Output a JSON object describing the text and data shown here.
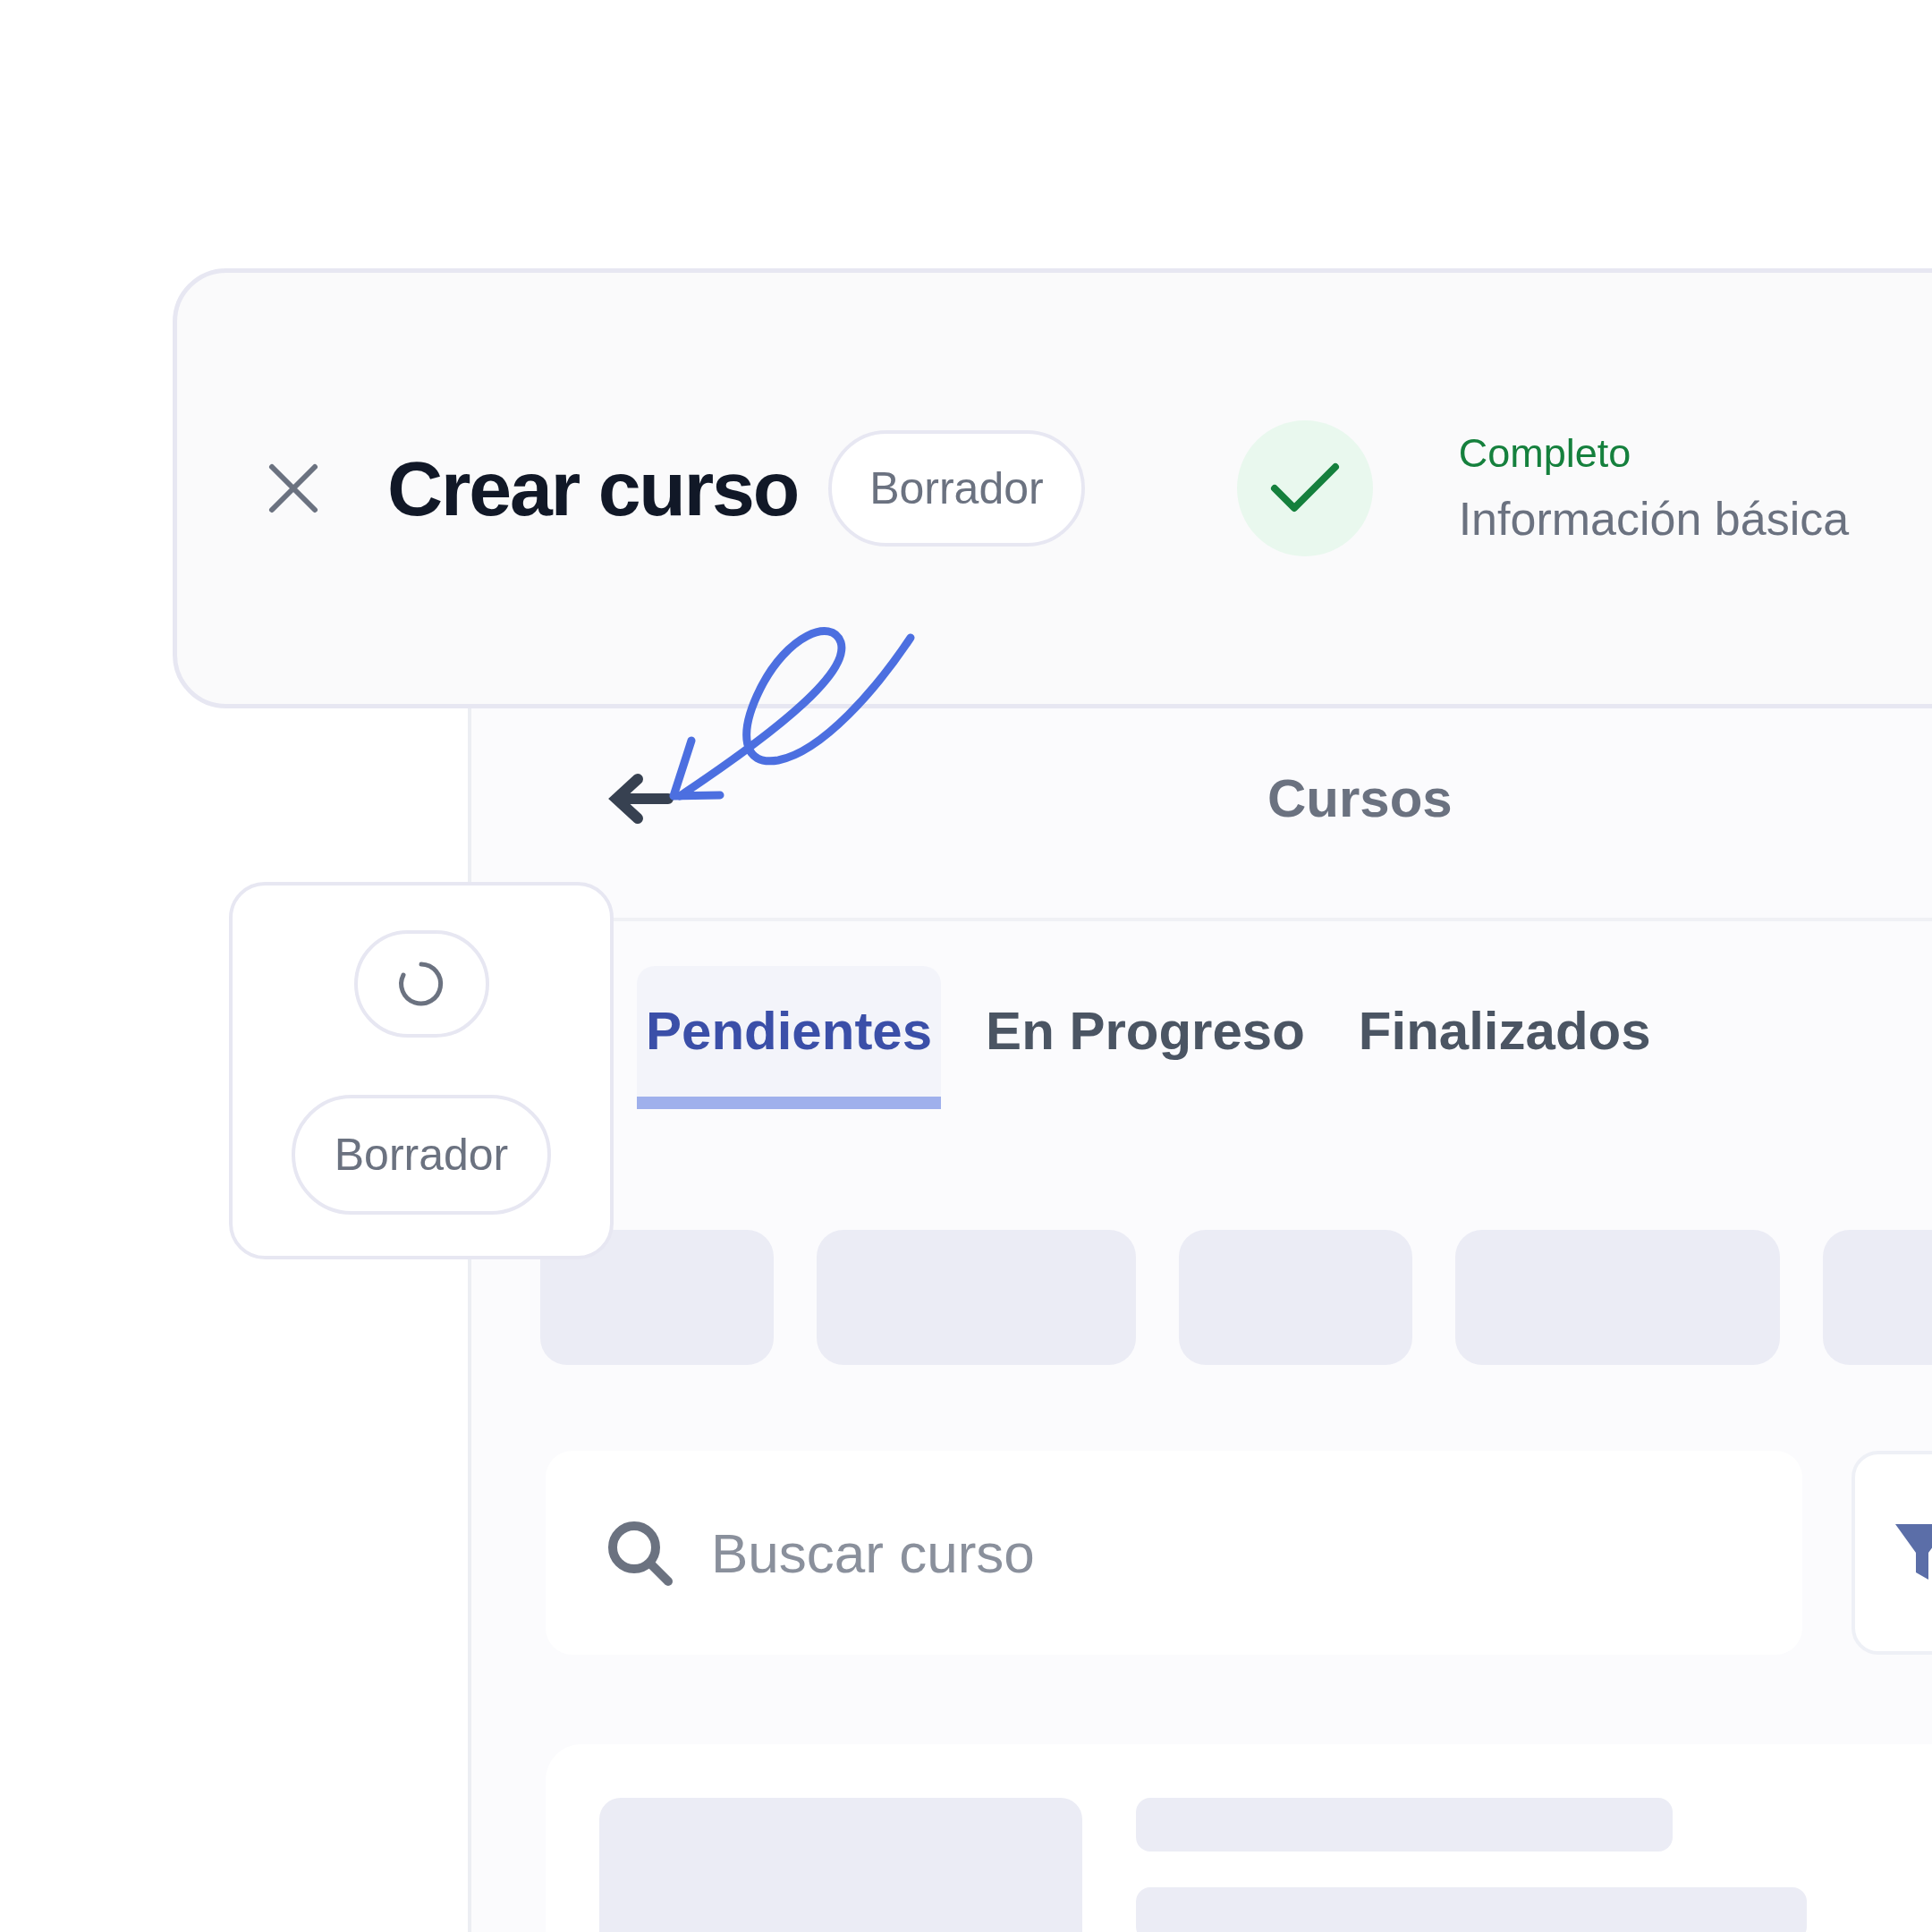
{
  "header": {
    "title": "Crear curso",
    "badge": "Borrador",
    "step": {
      "status": "Completo",
      "label": "Información básica",
      "complete": true
    }
  },
  "app": {
    "title": "Cursos",
    "tabs": [
      {
        "label": "Pendientes",
        "selected": true
      },
      {
        "label": "En Progreso",
        "selected": false
      },
      {
        "label": "Finalizados",
        "selected": false
      }
    ],
    "search": {
      "placeholder": "Buscar curso"
    }
  },
  "status_card": {
    "loading": true,
    "badge": "Borrador"
  }
}
